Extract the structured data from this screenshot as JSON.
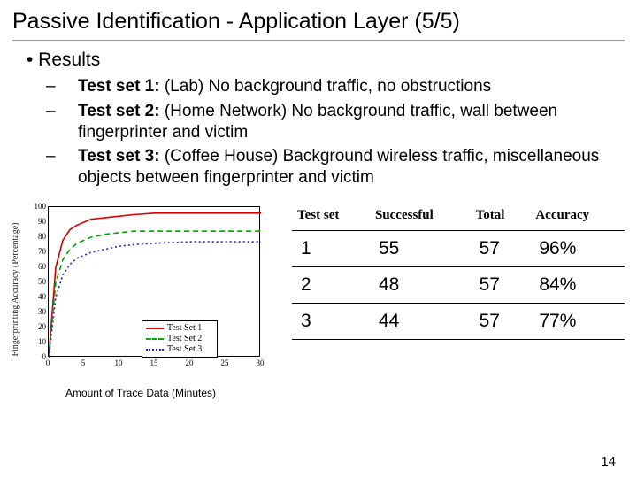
{
  "title": "Passive Identification - Application Layer (5/5)",
  "bullets": {
    "l1": "• Results",
    "items": [
      {
        "dash": "–  ",
        "bold": "Test set 1:",
        "rest": " (Lab) No background traffic, no obstructions"
      },
      {
        "dash": "–  ",
        "bold": "Test set 2:",
        "rest": " (Home Network) No background traffic, wall between fingerprinter and victim"
      },
      {
        "dash": "–  ",
        "bold": "Test set 3:",
        "rest": " (Coffee House) Background wireless traffic, miscellaneous objects between fingerprinter and victim"
      }
    ]
  },
  "chart_data": {
    "type": "line",
    "xlabel": "Amount of Trace Data (Minutes)",
    "ylabel": "Fingerprinting Accuracy (Percentage)",
    "xlim": [
      0,
      30
    ],
    "ylim": [
      0,
      100
    ],
    "xticks": [
      0,
      5,
      10,
      15,
      20,
      25,
      30
    ],
    "yticks": [
      0,
      10,
      20,
      30,
      40,
      50,
      60,
      70,
      80,
      90,
      100
    ],
    "series": [
      {
        "name": "Test Set 1",
        "color": "#d00000",
        "style": "solid",
        "values": [
          [
            0,
            0
          ],
          [
            1,
            60
          ],
          [
            2,
            78
          ],
          [
            3,
            85
          ],
          [
            4,
            88
          ],
          [
            5,
            90
          ],
          [
            6,
            92
          ],
          [
            8,
            93
          ],
          [
            10,
            94
          ],
          [
            12,
            95
          ],
          [
            15,
            96
          ],
          [
            20,
            96
          ],
          [
            25,
            96
          ],
          [
            30,
            96
          ]
        ]
      },
      {
        "name": "Test Set 2",
        "color": "#00a000",
        "style": "dashed",
        "values": [
          [
            0,
            0
          ],
          [
            1,
            50
          ],
          [
            2,
            65
          ],
          [
            3,
            72
          ],
          [
            4,
            76
          ],
          [
            5,
            78
          ],
          [
            6,
            80
          ],
          [
            8,
            82
          ],
          [
            10,
            83
          ],
          [
            12,
            84
          ],
          [
            15,
            84
          ],
          [
            20,
            84
          ],
          [
            25,
            84
          ],
          [
            30,
            84
          ]
        ]
      },
      {
        "name": "Test Set 3",
        "color": "#2020c0",
        "style": "dotted",
        "values": [
          [
            0,
            0
          ],
          [
            1,
            40
          ],
          [
            2,
            55
          ],
          [
            3,
            62
          ],
          [
            4,
            66
          ],
          [
            5,
            68
          ],
          [
            6,
            70
          ],
          [
            8,
            72
          ],
          [
            10,
            74
          ],
          [
            12,
            75
          ],
          [
            15,
            76
          ],
          [
            20,
            77
          ],
          [
            25,
            77
          ],
          [
            30,
            77
          ]
        ]
      }
    ],
    "legend": [
      "Test Set 1",
      "Test Set 2",
      "Test Set 3"
    ]
  },
  "table": {
    "headers": [
      "Test set",
      "Successful",
      "Total",
      "Accuracy"
    ],
    "rows": [
      [
        "1",
        "55",
        "57",
        "96%"
      ],
      [
        "2",
        "48",
        "57",
        "84%"
      ],
      [
        "3",
        "44",
        "57",
        "77%"
      ]
    ]
  },
  "page_number": "14"
}
